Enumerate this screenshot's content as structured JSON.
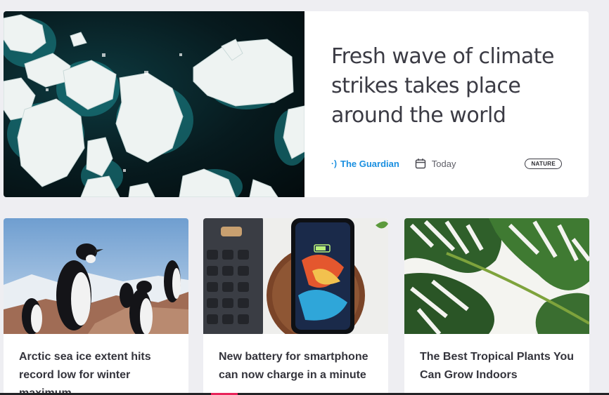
{
  "featured": {
    "title": "Fresh wave of climate strikes takes place around the world",
    "source": "The Guardian",
    "source_icon": "broadcast-icon",
    "date": "Today",
    "date_icon": "calendar-icon",
    "tag": "NATURE",
    "image": "sea-ice-aerial-image"
  },
  "cards": [
    {
      "title": "Arctic sea ice extent hits record low for winter maximum",
      "image": "penguins-image"
    },
    {
      "title": "New battery for smartphone can now charge in a minute",
      "image": "phone-charger-image"
    },
    {
      "title": "The Best Tropical Plants You Can Grow Indoors",
      "image": "monstera-plant-image"
    }
  ],
  "colors": {
    "background": "#eeeef2",
    "source_link": "#1a8fe0",
    "title_text": "#3b3b44",
    "card_title": "#34343c"
  }
}
